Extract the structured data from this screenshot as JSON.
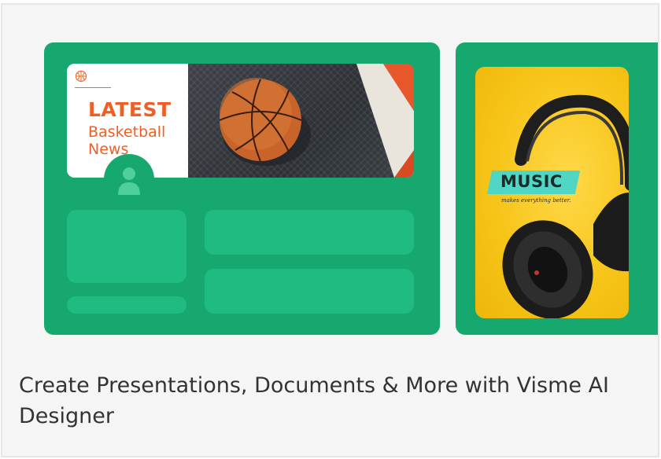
{
  "card": {
    "caption": "Create Presentations, Documents & More with Visme AI Designer"
  },
  "preview": {
    "banner": {
      "headline": "LATEST",
      "subheadline": "Basketball\nNews",
      "ball_icon": "basketball-icon",
      "avatar_icon": "user-icon"
    },
    "music_card": {
      "title": "MUSIC",
      "tagline": "makes everything better."
    }
  },
  "colors": {
    "panel_green": "#17a870",
    "block_green": "#20bb80",
    "headline_orange": "#ee5f26",
    "music_yellow": "#f7c519",
    "music_tag_teal": "#4fd6c4",
    "caption_text": "#333333"
  }
}
